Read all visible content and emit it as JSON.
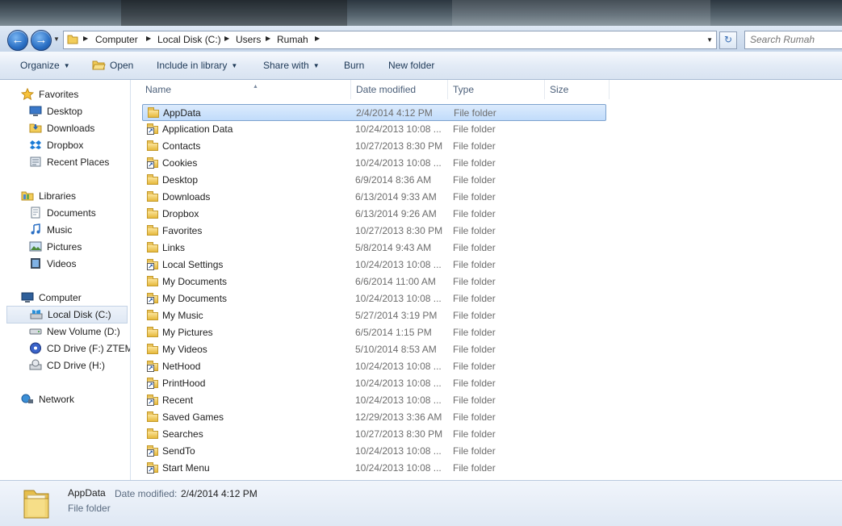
{
  "address": {
    "crumbs": [
      "Computer",
      "Local Disk (C:)",
      "Users",
      "Rumah"
    ]
  },
  "search": {
    "placeholder": "Search Rumah"
  },
  "toolbar": {
    "organize": "Organize",
    "open": "Open",
    "include_in_library": "Include in library",
    "share_with": "Share with",
    "burn": "Burn",
    "new_folder": "New folder"
  },
  "nav": {
    "favorites": "Favorites",
    "desktop": "Desktop",
    "downloads": "Downloads",
    "dropbox": "Dropbox",
    "recent_places": "Recent Places",
    "libraries": "Libraries",
    "documents": "Documents",
    "music": "Music",
    "pictures": "Pictures",
    "videos": "Videos",
    "computer": "Computer",
    "local_disk": "Local Disk (C:)",
    "new_volume": "New Volume (D:)",
    "cd_drive_f": "CD Drive (F:) ZTEMODEM",
    "cd_drive_h": "CD Drive (H:)",
    "network": "Network"
  },
  "columns": {
    "name": "Name",
    "date_modified": "Date modified",
    "type": "Type",
    "size": "Size"
  },
  "files": [
    {
      "name": "AppData",
      "date": "2/4/2014 4:12 PM",
      "type": "File folder",
      "icon": "folder-icon"
    },
    {
      "name": "Application Data",
      "date": "10/24/2013 10:08 ...",
      "type": "File folder",
      "icon": "shortcut-icon"
    },
    {
      "name": "Contacts",
      "date": "10/27/2013 8:30 PM",
      "type": "File folder",
      "icon": "folder-icon"
    },
    {
      "name": "Cookies",
      "date": "10/24/2013 10:08 ...",
      "type": "File folder",
      "icon": "shortcut-icon"
    },
    {
      "name": "Desktop",
      "date": "6/9/2014 8:36 AM",
      "type": "File folder",
      "icon": "folder-icon"
    },
    {
      "name": "Downloads",
      "date": "6/13/2014 9:33 AM",
      "type": "File folder",
      "icon": "folder-icon"
    },
    {
      "name": "Dropbox",
      "date": "6/13/2014 9:26 AM",
      "type": "File folder",
      "icon": "folder-icon"
    },
    {
      "name": "Favorites",
      "date": "10/27/2013 8:30 PM",
      "type": "File folder",
      "icon": "folder-icon"
    },
    {
      "name": "Links",
      "date": "5/8/2014 9:43 AM",
      "type": "File folder",
      "icon": "folder-icon"
    },
    {
      "name": "Local Settings",
      "date": "10/24/2013 10:08 ...",
      "type": "File folder",
      "icon": "shortcut-icon"
    },
    {
      "name": "My Documents",
      "date": "6/6/2014 11:00 AM",
      "type": "File folder",
      "icon": "folder-icon"
    },
    {
      "name": "My Documents",
      "date": "10/24/2013 10:08 ...",
      "type": "File folder",
      "icon": "shortcut-icon"
    },
    {
      "name": "My Music",
      "date": "5/27/2014 3:19 PM",
      "type": "File folder",
      "icon": "folder-icon"
    },
    {
      "name": "My Pictures",
      "date": "6/5/2014 1:15 PM",
      "type": "File folder",
      "icon": "folder-icon"
    },
    {
      "name": "My Videos",
      "date": "5/10/2014 8:53 AM",
      "type": "File folder",
      "icon": "folder-icon"
    },
    {
      "name": "NetHood",
      "date": "10/24/2013 10:08 ...",
      "type": "File folder",
      "icon": "shortcut-icon"
    },
    {
      "name": "PrintHood",
      "date": "10/24/2013 10:08 ...",
      "type": "File folder",
      "icon": "shortcut-icon"
    },
    {
      "name": "Recent",
      "date": "10/24/2013 10:08 ...",
      "type": "File folder",
      "icon": "shortcut-icon"
    },
    {
      "name": "Saved Games",
      "date": "12/29/2013 3:36 AM",
      "type": "File folder",
      "icon": "folder-icon"
    },
    {
      "name": "Searches",
      "date": "10/27/2013 8:30 PM",
      "type": "File folder",
      "icon": "folder-icon"
    },
    {
      "name": "SendTo",
      "date": "10/24/2013 10:08 ...",
      "type": "File folder",
      "icon": "shortcut-icon"
    },
    {
      "name": "Start Menu",
      "date": "10/24/2013 10:08 ...",
      "type": "File folder",
      "icon": "shortcut-icon"
    }
  ],
  "details": {
    "name": "AppData",
    "date_label": "Date modified:",
    "date_value": "2/4/2014 4:12 PM",
    "type": "File folder"
  },
  "colors": {
    "selection": "#c1dcfb",
    "toolbar": "#e3ebf6",
    "accent": "#2a6fc4"
  }
}
